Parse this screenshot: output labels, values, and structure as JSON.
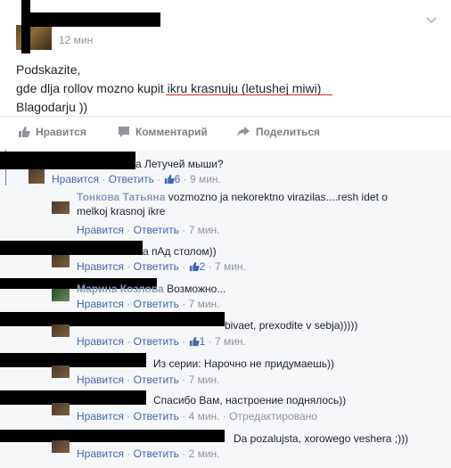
{
  "post": {
    "time": "12 мин",
    "lines": [
      "Podskazite,",
      "gde dlja rollov mozno kupit ikru krasnuju (letushej miwi)",
      "Blagodarju ))"
    ]
  },
  "actions": {
    "like": "Нравится",
    "comment": "Комментарий",
    "share": "Поделиться"
  },
  "comments": [
    {
      "text": "а Летучей мыши?",
      "like": "Нравится",
      "reply": "Ответить",
      "likes": "6",
      "time": "9 мин."
    },
    {
      "name": "Тонкова Татьяна",
      "text": "vozmozno ja nekorektno virazilas....resh idet o",
      "text2": "melkoj krasnoj ikre",
      "like": "Нравится",
      "reply": "Ответить",
      "time": "7 мин."
    },
    {
      "text": "а пАд столом))",
      "like": "Нравится",
      "reply": "Ответить",
      "likes": "2",
      "time": "7 мин."
    },
    {
      "name": "Марина Козлова",
      "text": "Возможно...",
      "like": "Нравится",
      "reply": "Ответить",
      "time": "7 мин."
    },
    {
      "text": "bivaet, prexodite v sebja)))))",
      "like": "Нравится",
      "reply": "Ответить",
      "likes": "1",
      "time": "7 мин."
    },
    {
      "text": "Из серии: Нарочно не придумаешь))",
      "like": "Нравится",
      "reply": "Ответить",
      "time": "7 мин."
    },
    {
      "text": "Спасибо Вам, настроение поднялось))",
      "like": "Нравится",
      "reply": "Ответить",
      "time": "4 мин.",
      "edited": "Отредактировано"
    },
    {
      "text": "Da pozalujsta, xorowego veshera ;)))",
      "like": "Нравится",
      "reply": "Ответить",
      "time": "2 мин."
    }
  ],
  "colors": {
    "link": "#4267b2",
    "underline": "#e02a2a"
  }
}
